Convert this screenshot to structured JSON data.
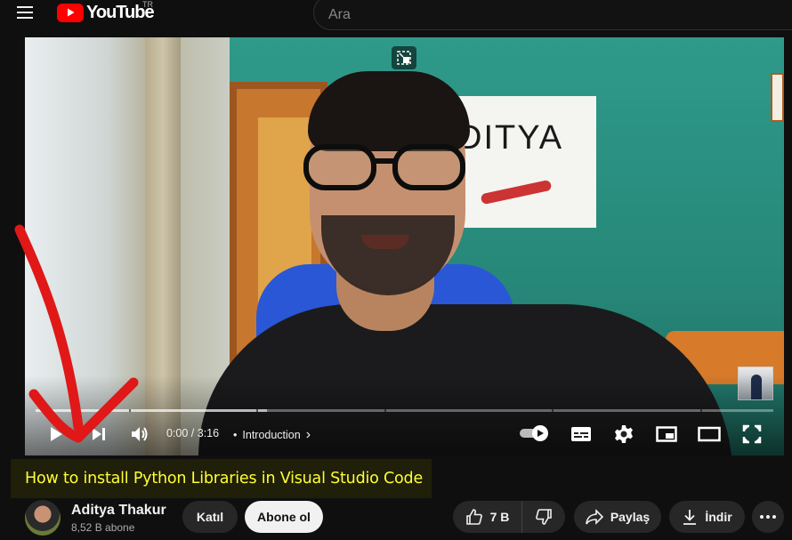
{
  "header": {
    "logo_text": "YouTube",
    "country": "TR",
    "search_placeholder": "Ara"
  },
  "player": {
    "current_time": "0:00",
    "separator": "/",
    "duration": "3:16",
    "chapter": "Introduction",
    "poster_text": "DITYA",
    "time_display": "0:00 / 3:16",
    "chapter_arrow": "›"
  },
  "video": {
    "title": "How to install Python Libraries in Visual Studio Code"
  },
  "channel": {
    "name": "Aditya Thakur",
    "subscribers": "8,52 B abone"
  },
  "actions": {
    "join": "Katıl",
    "subscribe": "Abone ol",
    "likes": "7 B",
    "share": "Paylaş",
    "download": "İndir"
  },
  "colors": {
    "youtube_red": "#ff0000",
    "title_highlight": "#ffff33",
    "annotation_arrow": "#e01818"
  }
}
